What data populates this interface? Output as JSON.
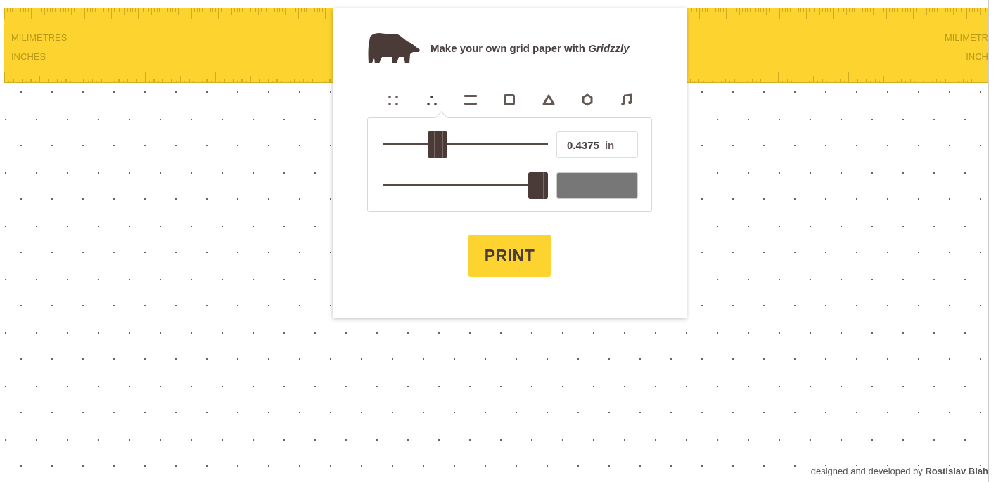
{
  "ruler": {
    "labels_left": [
      "MILIMETRES",
      "INCHES"
    ],
    "labels_right": [
      "MILIMETR",
      "INCH"
    ]
  },
  "panel": {
    "tagline": "Make your own grid paper with *Gridzzly*",
    "grid_types": [
      {
        "kind": "dots",
        "selected": false
      },
      {
        "kind": "triangle-dots",
        "selected": true
      },
      {
        "kind": "lines",
        "selected": false
      },
      {
        "kind": "square",
        "selected": false
      },
      {
        "kind": "triangle",
        "selected": false
      },
      {
        "kind": "hexagon",
        "selected": false
      },
      {
        "kind": "music",
        "selected": false
      }
    ],
    "spacing": {
      "level": 0.31,
      "value": "0.4375",
      "unit": "in"
    },
    "darkness": {
      "level": 1.0
    },
    "print_button": "PRINT"
  },
  "footer": "designed and developed by **Rostislav Blah**"
}
